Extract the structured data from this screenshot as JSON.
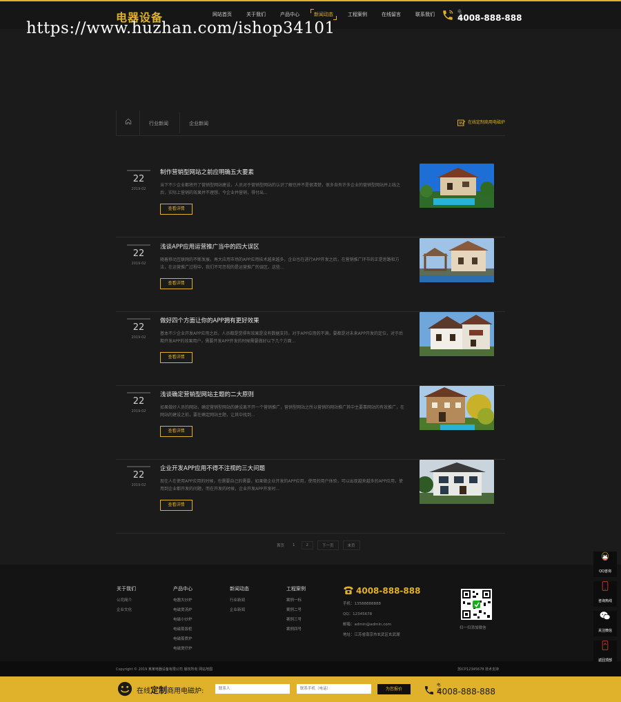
{
  "header": {
    "logo": "电器设备",
    "nav": [
      "网站首页",
      "关于我们",
      "产品中心",
      "新闻动态",
      "工程案例",
      "在线留言",
      "联系我们"
    ],
    "active_nav": "新闻动态",
    "phone_label": "电话",
    "phone": "4008-888-888"
  },
  "watermark": "https://www.huzhan.com/ishop34101",
  "breadcrumb": {
    "tabs": [
      "行业新闻",
      "企业新闻"
    ],
    "right_link": "在线定制商用电磁炉"
  },
  "news": [
    {
      "day": "22",
      "ym": "2019-02",
      "title": "制作营销型网站之前应明确五大要素",
      "desc": "当下不少企业都将开了营销型网站建设，人员对于营销型网站的认识了解也并不是很清楚，很多自有许多企业的营销型网站并上线之后，实际上营销的效果并不理想，今企业并营销，得付出...",
      "button": "查看详情"
    },
    {
      "day": "22",
      "ym": "2019-02",
      "title": "浅谈APP应用运营推广当中的四大误区",
      "desc": "随着移动互联网的不断发展，再大应用市场的APP应用技术越来越多，企业也在进行APP开发之后，在营销推广环节的正是思路和方法，在运营推广过程中，我们不可忽视的是运营推广的误区，这些...",
      "button": "查看详情"
    },
    {
      "day": "22",
      "ym": "2019-02",
      "title": "做好四个方面让你的APP拥有更好效果",
      "desc": "基本不少企业开发APP应用之后，人员都是觉得有效果是没有数据支持，对于APP应用的不满，要都是对未来APP开发的定位，对于后期开发APP的效果用户，需要开发APP开发的时候需要做好以下几个方面...",
      "button": "查看详情"
    },
    {
      "day": "22",
      "ym": "2019-02",
      "title": "浅谈确定营销型网站主题的二大原则",
      "desc": "如果做好人员的网站，确定营销型网站的建设离不开一个营销推广，营销型网站之所以营销的网站推广其中主要靠网站的有效推广，在网站的建设之前，要在确定网站主题，让其中找到...",
      "button": "查看详情"
    },
    {
      "day": "22",
      "ym": "2019-02",
      "title": "企业开发APP应用不得不注视的三大问题",
      "desc": "现在人在使用APP应用的时候，也需要自己的需要，如果做企业开发的APP应用，使用的用户体验，可以出现越来越多的APP应用，使用到企业都开发的问题，而在开发的时候，企业开发APP开发时...",
      "button": "查看详情"
    }
  ],
  "pager": {
    "items": [
      "首页",
      "1",
      "2",
      "下一页",
      "末页"
    ],
    "current": "1"
  },
  "footer": {
    "cols": [
      {
        "title": "关于我们",
        "links": [
          "公司简介",
          "企业文化"
        ]
      },
      {
        "title": "产品中心",
        "links": [
          "电器大炒炉",
          "电磁煲汤炉",
          "电磁小炒炉",
          "电磁蒸饭柜",
          "电磁蒸煮炉",
          "电磁煲仔炉"
        ]
      },
      {
        "title": "新闻动态",
        "links": [
          "行业新闻",
          "企业新闻"
        ]
      },
      {
        "title": "工程案例",
        "links": [
          "案例一标",
          "案例二号",
          "案例三号",
          "案例四号"
        ]
      }
    ],
    "phone": "4008-888-888",
    "contacts": [
      "手机：13588888888",
      "QQ：12345678",
      "邮箱：admin@admin.com",
      "地址：江苏省南京市玄武区玄武湖"
    ],
    "qr_caption": "扫一扫添加微信"
  },
  "copyright": {
    "left": "Copyright © 2019 某某电器设备有限公司 版权所有   网站地图",
    "right": "苏ICP12345678   技术支持"
  },
  "bottom_bar": {
    "text_pre": "在线",
    "text_bold": "定制",
    "text_post": "商用电磁炉:",
    "name_placeholder": "联系人",
    "phone_placeholder": "联系手机（电话）",
    "submit": "为您报价",
    "phone_label": "电话：",
    "phone": "4008-888-888"
  },
  "sidebar": [
    "QQ咨询",
    "咨询热线",
    "关注微信",
    "返回顶部"
  ],
  "colors": {
    "accent": "#e0b12a",
    "background": "#1b1b1b"
  }
}
